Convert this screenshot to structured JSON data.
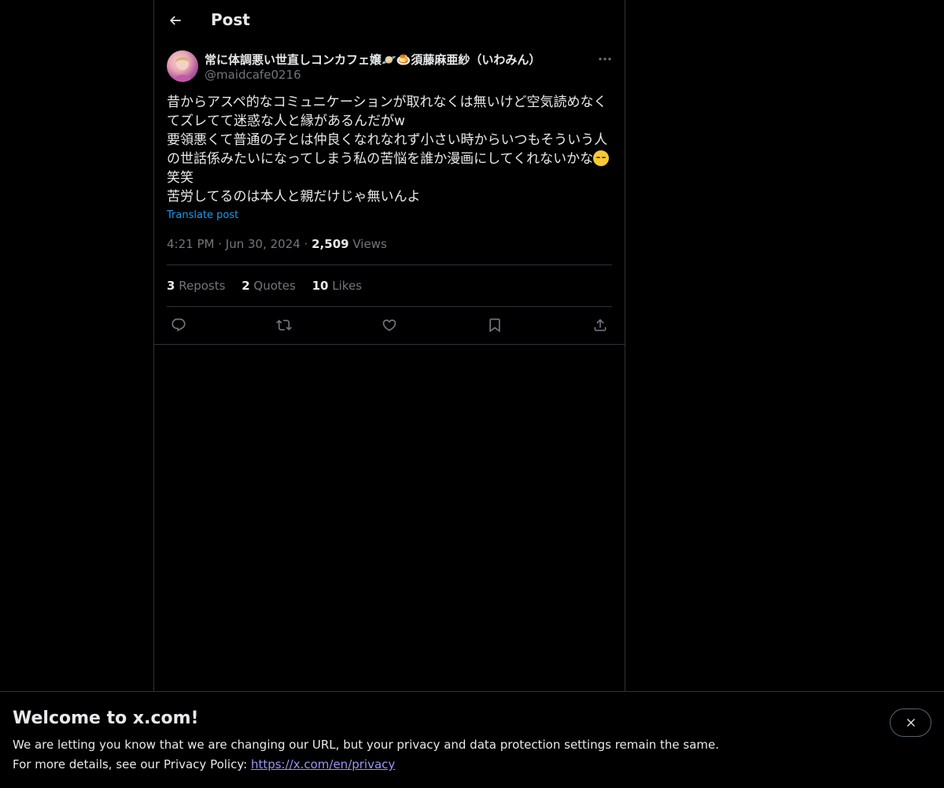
{
  "header": {
    "title": "Post"
  },
  "post": {
    "author": {
      "display_name": "常に体調悪い世直しコンカフェ嬢🪐🍮須藤麻亜紗（いわみん）",
      "handle": "@maidcafe0216"
    },
    "text_part1": "昔からアスペ的なコミュニケーションが取れなくは無いけど空気読めなくてズレてて迷惑な人と縁があるんだがw\n要領悪くて普通の子とは仲良くなれなれず小さい時からいつもそういう人の世話係みたいになってしまう私の苦悩を誰か漫画にしてくれないかな",
    "text_part2": "笑笑\n苦労してるのは本人と親だけじゃ無いんよ",
    "translate_label": "Translate post",
    "time": "4:21 PM",
    "date": "Jun 30, 2024",
    "views_count": "2,509",
    "views_label": "Views",
    "stats": {
      "reposts_count": "3",
      "reposts_label": "Reposts",
      "quotes_count": "2",
      "quotes_label": "Quotes",
      "likes_count": "10",
      "likes_label": "Likes"
    },
    "actions": [
      "reply-icon",
      "repost-icon",
      "like-icon",
      "bookmark-icon",
      "share-icon"
    ]
  },
  "banner": {
    "title": "Welcome to x.com!",
    "line1": "We are letting you know that we are changing our URL, but your privacy and data protection settings remain the same.",
    "line2_prefix": "For more details, see our Privacy Policy: ",
    "link": "https://x.com/en/privacy"
  },
  "colors": {
    "background": "#000000",
    "text": "#e7e9ea",
    "muted": "#71767b",
    "accent": "#1d9bf0",
    "border": "#2f3336",
    "link": "#9b95f5"
  }
}
